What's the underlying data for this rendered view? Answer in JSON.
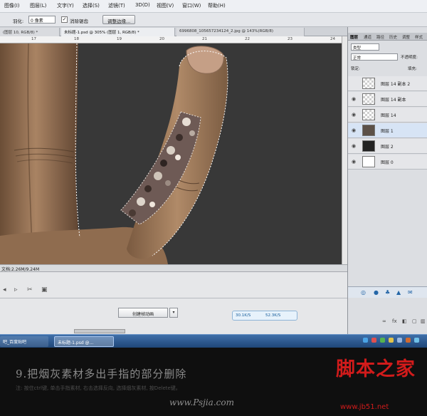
{
  "menu": {
    "items": [
      "图像(I)",
      "图层(L)",
      "文字(Y)",
      "选择(S)",
      "滤镜(T)",
      "3D(D)",
      "视图(V)",
      "窗口(W)",
      "帮助(H)"
    ]
  },
  "options": {
    "feather_label": "羽化:",
    "feather_value": "0 像素",
    "antialias_label": "消除锯齿",
    "antialias_checked": true,
    "refine_edge_button": "调整边缘..."
  },
  "document_tabs": [
    {
      "label": "(图层 10, RGB/8) *",
      "active": false
    },
    {
      "label": "未标题-1.psd @ 305% (图层 1, RGB/8) *",
      "active": true
    },
    {
      "label": "6996808_105657234124_2.jpg @ 143%(RGB/8)",
      "active": false
    }
  ],
  "ruler": {
    "numbers": [
      "17",
      "18",
      "19",
      "20",
      "21",
      "22",
      "23",
      "24"
    ]
  },
  "status": {
    "text": "文档:2.26M/9.24M"
  },
  "timeline": {
    "create_animation_button": "创建帧动画",
    "net_up": "30.1K/S",
    "net_down": "52.3K/S"
  },
  "panel": {
    "tabs": [
      "图层",
      "通道",
      "路径",
      "历史",
      "调整",
      "样式"
    ],
    "filter_kind": "类型",
    "blend_mode": "正常",
    "opacity_label": "不透明度:",
    "lock_label": "锁定:",
    "fill_label": "填充:",
    "layers": [
      {
        "name": "图层 14 副本 2",
        "visible": false,
        "thumb": "trans",
        "selected": false
      },
      {
        "name": "图层 14 副本",
        "visible": true,
        "thumb": "trans",
        "selected": false
      },
      {
        "name": "图层 14",
        "visible": true,
        "thumb": "trans",
        "selected": false
      },
      {
        "name": "图层 1",
        "visible": true,
        "thumb": "hand",
        "selected": true
      },
      {
        "name": "图层 2",
        "visible": true,
        "thumb": "black",
        "selected": false
      },
      {
        "name": "图层 0",
        "visible": true,
        "thumb": "white",
        "selected": false
      }
    ],
    "footer_fx": "fx"
  },
  "taskbar": {
    "items": [
      "吧_百度贴吧",
      "未标题-1.psd @..."
    ]
  },
  "caption": {
    "title": "9.把烟灰素材多出手指的部分删除",
    "subtitle": "注: 按住ctrl键, 单击手指素材, 右击选择反向, 选择烟灰素材, 按Delete键。",
    "site": "www.Psjia.com"
  },
  "watermark": {
    "logo_text": "脚本之家",
    "url": "www.jb51.net"
  },
  "colors": {
    "canvas_bg": "#383838",
    "selected_layer": "#d7e4f5",
    "taskbar": "#2a5589",
    "logo_red": "#d11b1b"
  }
}
